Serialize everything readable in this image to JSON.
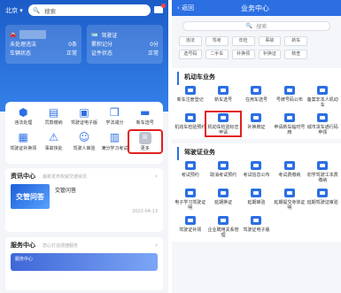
{
  "left": {
    "city": "北京",
    "search_label": "搜索",
    "cards": [
      {
        "title": "",
        "rows": [
          {
            "k": "未处理违法",
            "v": "0条"
          },
          {
            "k": "车辆状态",
            "v": "正常"
          }
        ]
      },
      {
        "title": "驾驶证",
        "rows": [
          {
            "k": "累积记分",
            "v": "0分"
          },
          {
            "k": "证件状态",
            "v": "正常"
          }
        ]
      }
    ],
    "services": [
      {
        "label": "违法处理",
        "icon": "shield-icon"
      },
      {
        "label": "罚款缴纳",
        "icon": "receipt-icon"
      },
      {
        "label": "驾驶证电子版",
        "icon": "license-icon"
      },
      {
        "label": "学法减分",
        "icon": "book-icon"
      },
      {
        "label": "新车选号",
        "icon": "car-icon"
      },
      {
        "label": "驾驶证补换领",
        "icon": "card-icon"
      },
      {
        "label": "事故快处",
        "icon": "crash-icon"
      },
      {
        "label": "驾驶人审验",
        "icon": "person-icon"
      },
      {
        "label": "满分学习考试",
        "icon": "calendar-icon"
      },
      {
        "label": "更多",
        "icon": "more-grid-icon"
      }
    ],
    "news": {
      "title": "资讯中心",
      "subtitle": "最新发布权威交通资讯",
      "image_text": "交管问答",
      "article_title": "交管问答",
      "date": "2022-04-13"
    },
    "service_center": {
      "title": "服务中心",
      "subtitle": "您心打造便捷服务",
      "banner_text": "服务中心"
    }
  },
  "right": {
    "back_label": "返回",
    "title": "业务中心",
    "search_label": "搜索",
    "tags": [
      "违法",
      "驾考",
      "年检",
      "事故",
      "新车",
      "选号码",
      "二手车",
      "补换领",
      "补换证",
      "核查"
    ],
    "vehicle_section": {
      "title": "机动车业务",
      "items": [
        {
          "label": "新车注册登记"
        },
        {
          "label": "新车选号"
        },
        {
          "label": "在用车选号"
        },
        {
          "label": "号牌号码公布"
        },
        {
          "label": "备案非本人机动车"
        },
        {
          "label": "机动车检验预约"
        },
        {
          "label": "机动车检验标志申请"
        },
        {
          "label": "补换牌证"
        },
        {
          "label": "申请新车临时号牌"
        },
        {
          "label": "城市货车通行码申领"
        }
      ]
    },
    "license_section": {
      "title": "驾驶证业务",
      "items": [
        {
          "label": "考试预约"
        },
        {
          "label": "取消考试预约"
        },
        {
          "label": "考试信息公布"
        },
        {
          "label": "考试费缴纳"
        },
        {
          "label": "初学驾驶工本费缴纳"
        },
        {
          "label": "电子学习驾驶证明"
        },
        {
          "label": "延期换证"
        },
        {
          "label": "延期审验"
        },
        {
          "label": "延期提交身体证明"
        },
        {
          "label": "延期驾驶证审验"
        },
        {
          "label": "驾驶证补领"
        },
        {
          "label": "企业聘用关系管理"
        },
        {
          "label": "驾驶证电子版"
        }
      ]
    }
  },
  "colors": {
    "primary": "#2b6fe3",
    "highlight": "#e02020"
  }
}
